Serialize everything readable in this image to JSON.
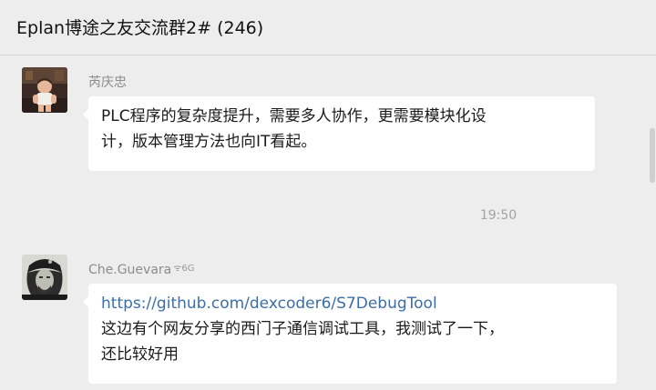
{
  "header": {
    "title": "Eplan博途之友交流群2# (246)"
  },
  "messages": [
    {
      "sender": "芮庆忠",
      "text": "PLC程序的复杂度提升，需要多人协作，更需要模块化设计，版本管理方法也向IT看起。",
      "line1": "PLC程序的复杂度提升，需要多人协作，更需要模块化设",
      "line2": "计，版本管理方法也向IT看起。"
    },
    {
      "sender": "Che.Guevara",
      "signal": "ᯤ6G",
      "link": "https://github.com/dexcoder6/S7DebugTool",
      "line1": "这边有个网友分享的西门子通信调试工具，我测试了一下，",
      "line2": "还比较好用"
    }
  ],
  "timestamp": "19:50",
  "colors": {
    "background": "#ededed",
    "bubble": "#ffffff",
    "link": "#3b6ea8",
    "meta_text": "#8c8c8c"
  }
}
